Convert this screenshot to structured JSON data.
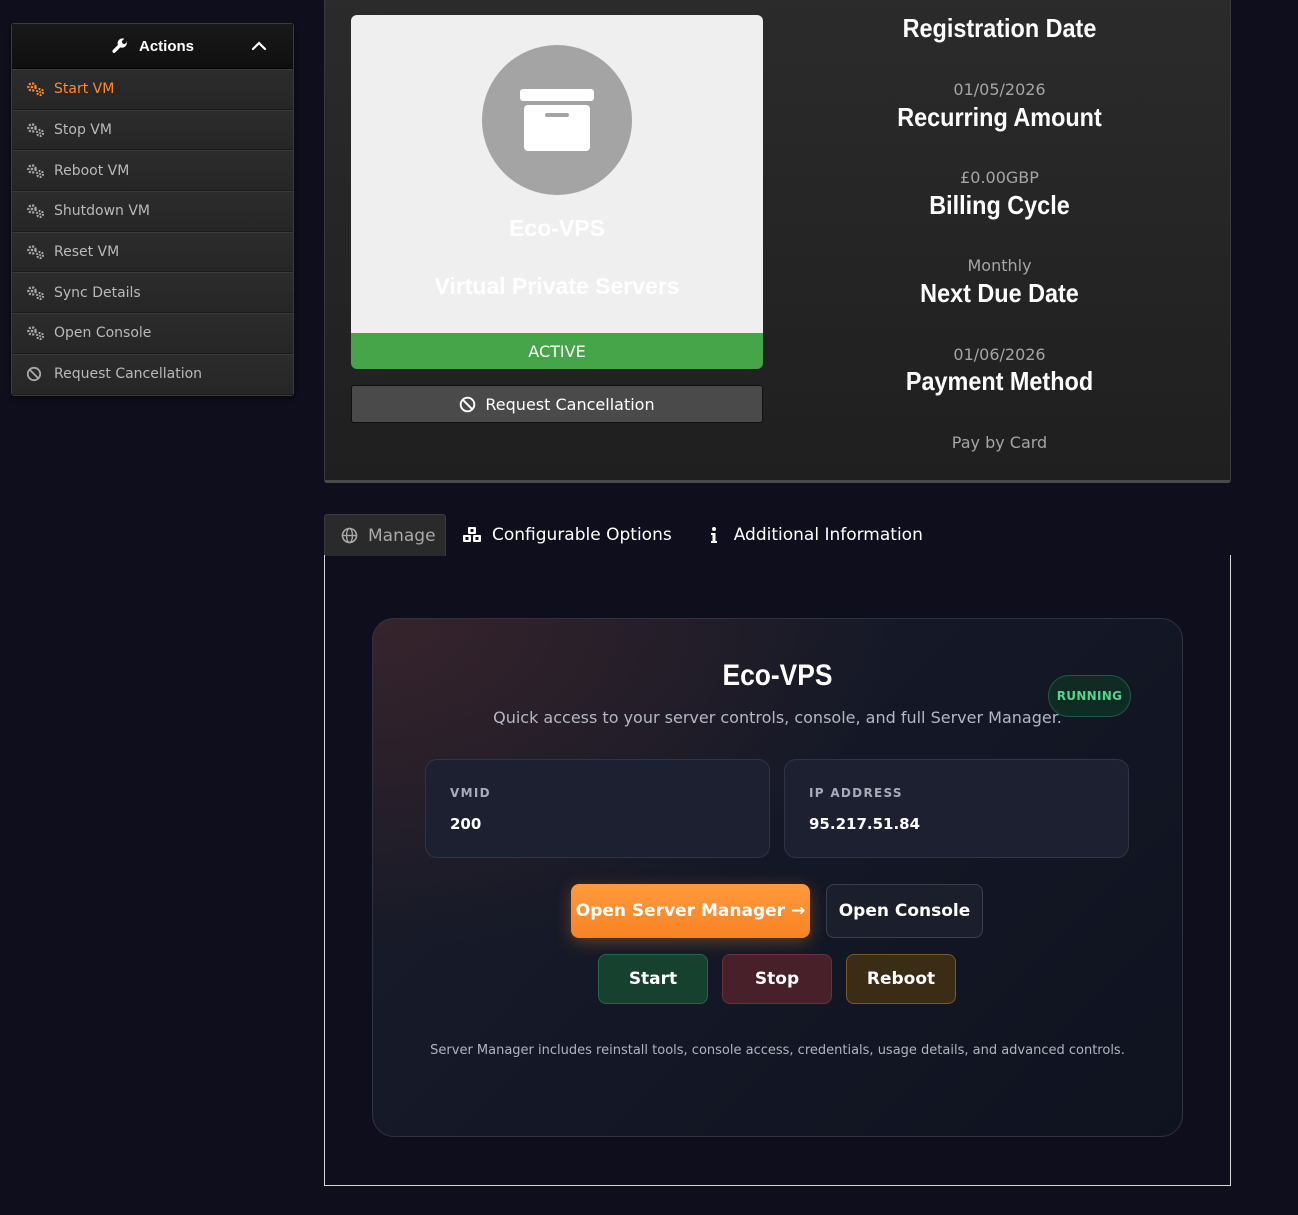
{
  "sidebar": {
    "title": "Actions",
    "items": [
      {
        "label": "Start VM",
        "icon": "gears-icon"
      },
      {
        "label": "Stop VM",
        "icon": "gears-icon"
      },
      {
        "label": "Reboot VM",
        "icon": "gears-icon"
      },
      {
        "label": "Shutdown VM",
        "icon": "gears-icon"
      },
      {
        "label": "Reset VM",
        "icon": "gears-icon"
      },
      {
        "label": "Sync Details",
        "icon": "gears-icon"
      },
      {
        "label": "Open Console",
        "icon": "gears-icon"
      },
      {
        "label": "Request Cancellation",
        "icon": "ban-icon"
      }
    ]
  },
  "product": {
    "name": "Eco-VPS",
    "group": "Virtual Private Servers",
    "status": "ACTIVE",
    "cancel_label": "Request Cancellation"
  },
  "details": {
    "registration_label": "Registration Date",
    "registration_value": "01/05/2026",
    "recurring_label": "Recurring Amount",
    "recurring_value": "£0.00GBP",
    "billing_label": "Billing Cycle",
    "billing_value": "Monthly",
    "due_label": "Next Due Date",
    "due_value": "01/06/2026",
    "payment_label": "Payment Method",
    "payment_value": "Pay by Card"
  },
  "tabs": [
    {
      "label": "Manage"
    },
    {
      "label": "Configurable Options"
    },
    {
      "label": "Additional Information"
    }
  ],
  "manage": {
    "title": "Eco-VPS",
    "subtitle": "Quick access to your server controls, console, and full Server Manager.",
    "badge": "RUNNING",
    "vmid_label": "VMID",
    "vmid_value": "200",
    "ip_label": "IP ADDRESS",
    "ip_value": "95.217.51.84",
    "open_manager": "Open Server Manager →",
    "open_console": "Open Console",
    "start": "Start",
    "stop": "Stop",
    "reboot": "Reboot",
    "footer": "Server Manager includes reinstall tools, console access, credentials, usage details, and advanced controls."
  },
  "colors": {
    "accent": "#ff8a2a",
    "active_status": "#46a549",
    "running": "#56d68c",
    "background": "#0f0e1c"
  }
}
